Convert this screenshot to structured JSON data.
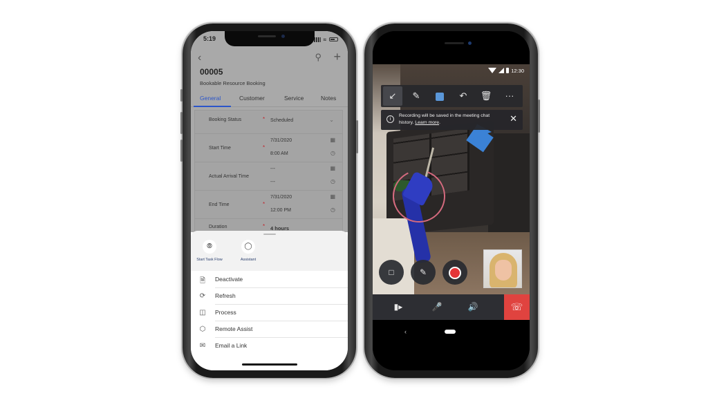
{
  "left_phone": {
    "status_bar": {
      "time": "5:19"
    },
    "header": {
      "record_id": "00005",
      "record_type": "Bookable Resource Booking"
    },
    "tabs": [
      {
        "label": "General",
        "active": true
      },
      {
        "label": "Customer",
        "active": false
      },
      {
        "label": "Service",
        "active": false
      },
      {
        "label": "Notes",
        "active": false
      }
    ],
    "form": {
      "booking_status": {
        "label": "Booking Status",
        "value": "Scheduled",
        "required": true
      },
      "start_time": {
        "label": "Start Time",
        "date": "7/31/2020",
        "time": "8:00 AM",
        "required": true
      },
      "actual_arrival_time": {
        "label": "Actual Arrival Time",
        "date": "---",
        "time": "---",
        "required": false
      },
      "end_time": {
        "label": "End Time",
        "date": "7/31/2020",
        "time": "12:00 PM",
        "required": true
      },
      "duration": {
        "label": "Duration",
        "value": "4 hours",
        "required": true
      },
      "required_marker": "*"
    },
    "sheet": {
      "quick_actions": [
        {
          "label": "Start Task Flow",
          "icon": "task-flow-icon"
        },
        {
          "label": "Assistant",
          "icon": "lightbulb-icon"
        }
      ],
      "menu_items": [
        {
          "label": "Deactivate",
          "icon": "deactivate-document-icon"
        },
        {
          "label": "Refresh",
          "icon": "refresh-icon"
        },
        {
          "label": "Process",
          "icon": "process-icon"
        },
        {
          "label": "Remote Assist",
          "icon": "remote-assist-icon"
        },
        {
          "label": "Email a Link",
          "icon": "email-link-icon"
        }
      ]
    }
  },
  "right_phone": {
    "status_bar": {
      "time": "12:30"
    },
    "ink_toolbar": {
      "tools": [
        "exit-annotation-icon",
        "pen-icon",
        "color-swatch",
        "undo-icon",
        "delete-icon",
        "more-icon"
      ],
      "more_label": "···",
      "swatch_color": "#5a97d9"
    },
    "banner": {
      "message": "Recording will be saved in the meeting chat history.",
      "link": "Learn more",
      "suffix": "."
    },
    "call_controls": {
      "floating": [
        "chat-icon",
        "snapshot-annotate-icon",
        "record-icon"
      ],
      "bar": [
        "video-camera-icon",
        "microphone-icon",
        "speaker-icon",
        "end-call-icon"
      ],
      "end_call_color": "#e0433f"
    }
  }
}
